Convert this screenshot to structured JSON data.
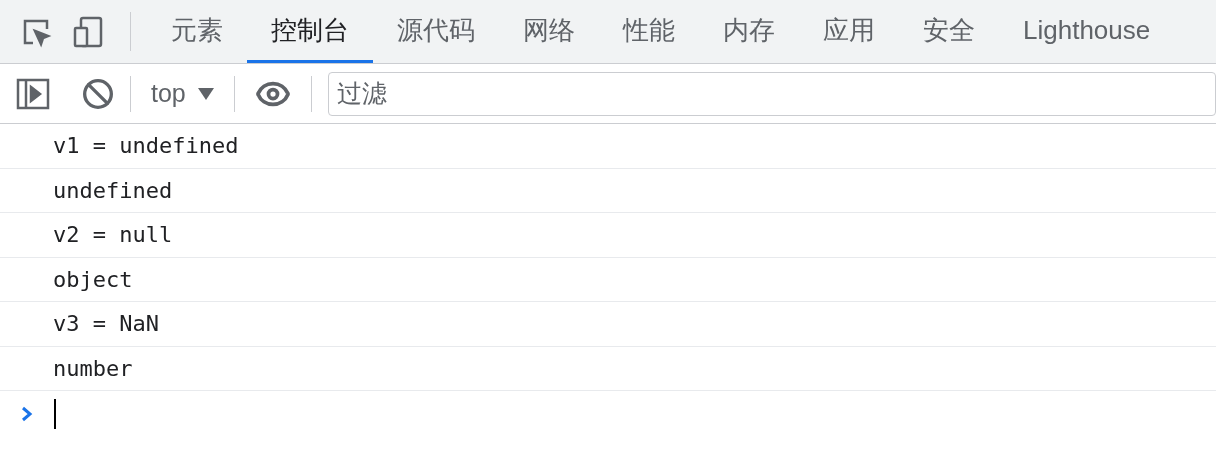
{
  "tabs": [
    {
      "label": "元素",
      "selected": false
    },
    {
      "label": "控制台",
      "selected": true
    },
    {
      "label": "源代码",
      "selected": false
    },
    {
      "label": "网络",
      "selected": false
    },
    {
      "label": "性能",
      "selected": false
    },
    {
      "label": "内存",
      "selected": false
    },
    {
      "label": "应用",
      "selected": false
    },
    {
      "label": "安全",
      "selected": false
    },
    {
      "label": "Lighthouse",
      "selected": false
    }
  ],
  "toolbar": {
    "context": "top",
    "filter": {
      "placeholder": "过滤"
    }
  },
  "messages": [
    "v1 = undefined",
    "undefined",
    "v2 = null",
    "object",
    "v3 = NaN",
    "number"
  ]
}
